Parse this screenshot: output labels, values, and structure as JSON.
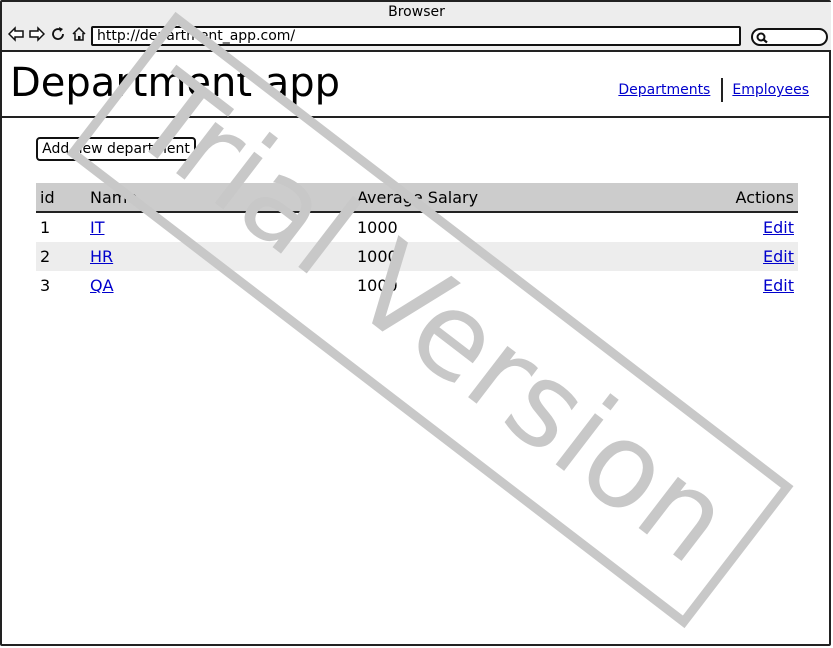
{
  "browser": {
    "title": "Browser",
    "url": "http://department_app.com/"
  },
  "header": {
    "title": "Department app",
    "nav": [
      {
        "label": "Departments"
      },
      {
        "label": "Employees"
      }
    ]
  },
  "main": {
    "add_button_label": "Add new department",
    "table": {
      "columns": [
        "id",
        "Name",
        "Average Salary",
        "Actions"
      ],
      "rows": [
        {
          "id": "1",
          "name": "IT",
          "salary": "1000",
          "action": "Edit"
        },
        {
          "id": "2",
          "name": "HR",
          "salary": "1000",
          "action": "Edit"
        },
        {
          "id": "3",
          "name": "QA",
          "salary": "1000",
          "action": "Edit"
        }
      ]
    }
  },
  "watermark": {
    "text": "Trial Version"
  },
  "colors": {
    "link": "#0000cc",
    "header_row": "#cccccc",
    "alt_row": "#ededed",
    "watermark": "#c8c8c8"
  }
}
